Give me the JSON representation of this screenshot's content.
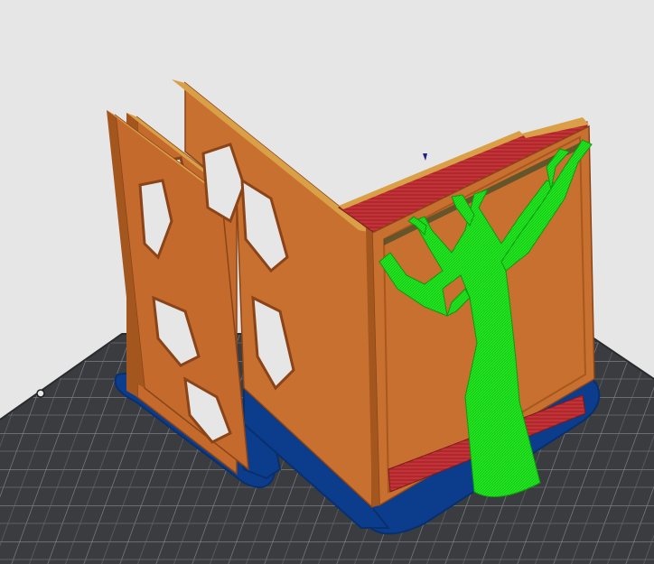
{
  "scene": {
    "view": "sliced-preview",
    "background_color": "#e6e6e6",
    "bed": {
      "surface_color": "#3a3c3f",
      "grid_color": "#8a8d92",
      "mount_holes": 2
    },
    "objects": [
      {
        "name": "hex-panel-front",
        "feature": "outer-wall",
        "color": "#c46a2c"
      },
      {
        "name": "hex-panel-rear",
        "feature": "outer-wall",
        "color": "#c46a2c"
      },
      {
        "name": "corner-box",
        "feature": "outer-wall",
        "color": "#c8702f"
      }
    ],
    "features": {
      "outer-wall": "#c8702f",
      "inner-wall": "#d88a3a",
      "top-solid-infill": "#b3262c",
      "support": "#19e619",
      "skirt-brim": "#0c3c8c",
      "wipe-tower": "#1a237e"
    },
    "support_structure": {
      "type": "tree",
      "color": "#19e619"
    }
  }
}
